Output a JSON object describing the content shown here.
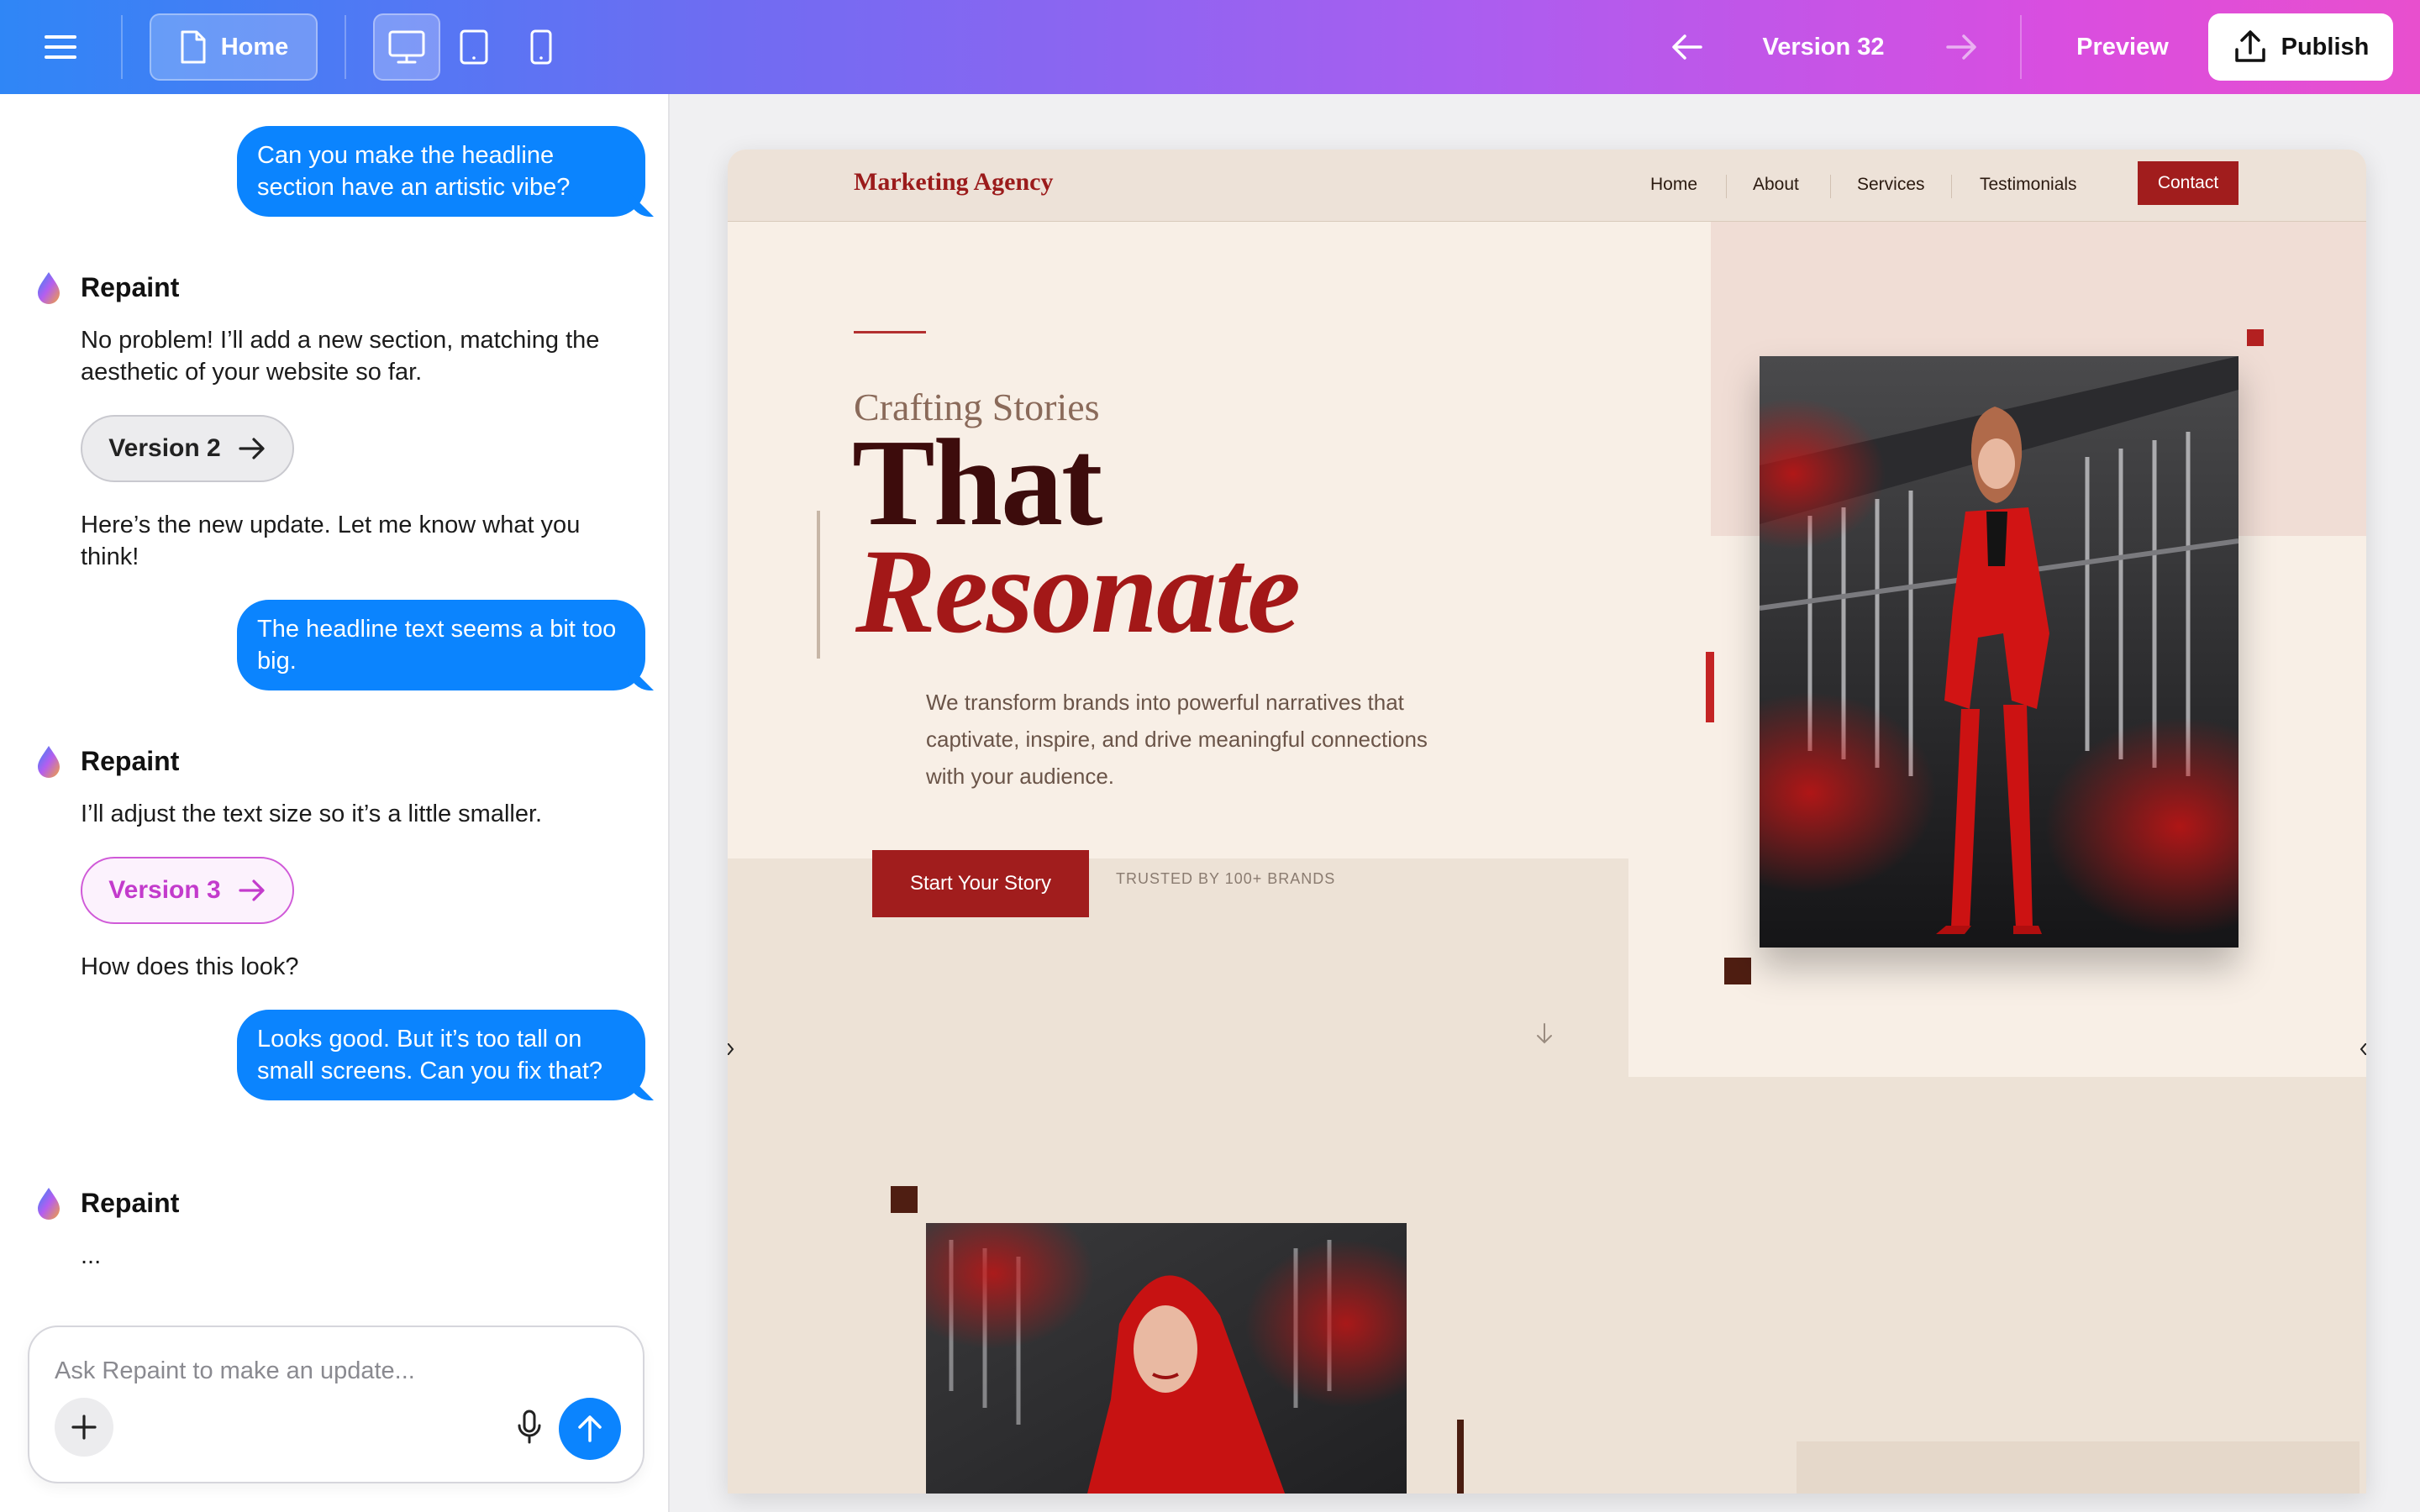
{
  "topbar": {
    "home_label": "Home",
    "version_label": "Version 32",
    "preview_label": "Preview",
    "publish_label": "Publish",
    "icons": [
      "menu-icon",
      "file-icon",
      "desktop-icon",
      "tablet-icon",
      "phone-icon",
      "arrow-left-icon",
      "arrow-right-icon",
      "upload-icon"
    ]
  },
  "chat": {
    "messages": [
      {
        "role": "user",
        "text": "Can you make the headline section have an artistic vibe?"
      },
      {
        "role": "bot",
        "name": "Repaint",
        "text": "No problem! I’ll add a new section, matching the aesthetic of your website so far.",
        "version": "Version 2",
        "followup": "Here’s the new update. Let me know what you think!"
      },
      {
        "role": "user",
        "text": "The headline text seems a bit too big."
      },
      {
        "role": "bot",
        "name": "Repaint",
        "text": "I’ll adjust the text size so it’s a little smaller.",
        "version": "Version 3",
        "followup": "How does this look?"
      },
      {
        "role": "user",
        "text": "Looks good. But it’s too tall on small screens. Can you fix that?"
      },
      {
        "role": "bot",
        "name": "Repaint",
        "text": "..."
      }
    ],
    "composer": {
      "placeholder": "Ask Repaint to make an update..."
    }
  },
  "site": {
    "logo": "Marketing Agency",
    "nav": [
      "Home",
      "About",
      "Services",
      "Testimonials"
    ],
    "contact": "Contact",
    "eyebrow": "Crafting Stories",
    "headline_1": "That",
    "headline_2": "Resonate",
    "lead": "We transform brands into powerful narratives that captivate, inspire, and drive meaningful connections with your audience.",
    "cta": "Start Your Story",
    "trusted": "TRUSTED BY 100+ BRANDS",
    "colors": {
      "brand_red": "#a11d1d",
      "dark_maroon": "#3d0c0c",
      "cream": "#f8efe6"
    }
  },
  "colors": {
    "accent_blue": "#0b84fe",
    "version3_accent": "#c33bcc"
  }
}
